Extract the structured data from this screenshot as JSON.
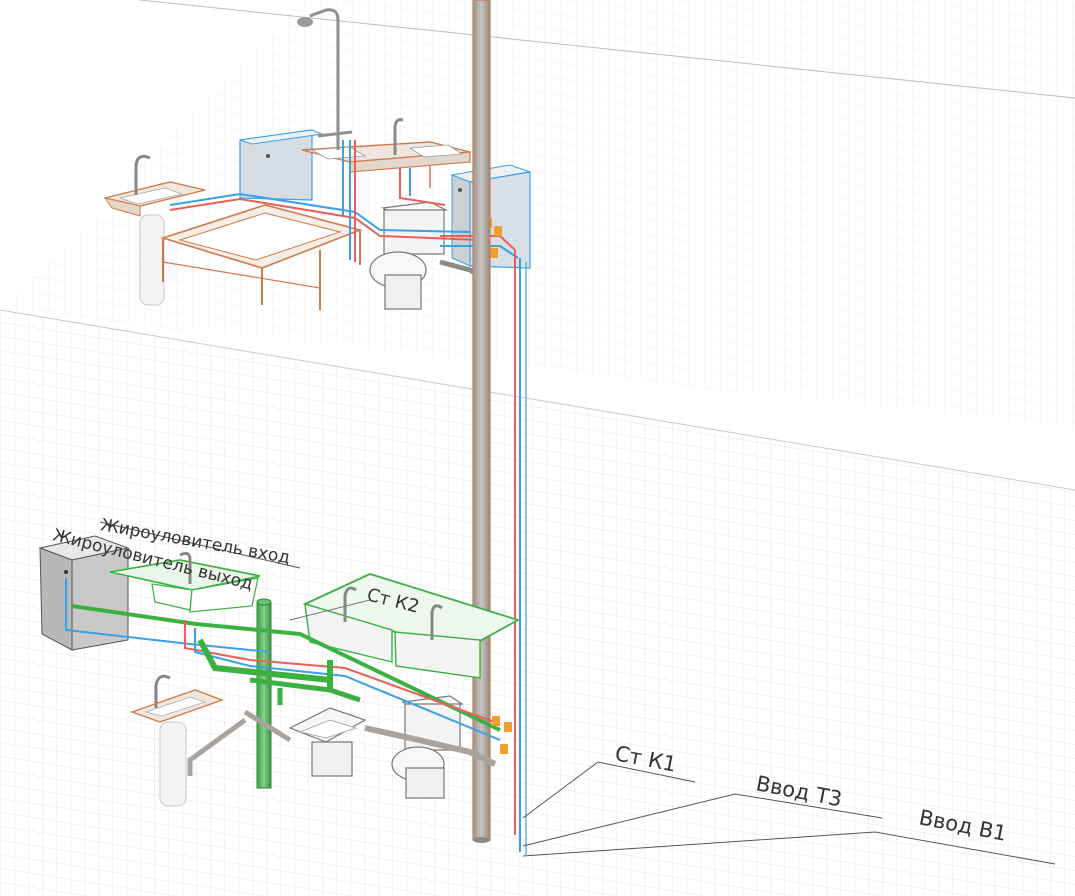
{
  "labels": {
    "grease_trap_in": "Жироуловитель вход",
    "grease_trap_out": "Жироуловитель выход",
    "riser_k2": "Ст К2",
    "riser_k1": "Ст К1",
    "inlet_t3": "Ввод Т3",
    "inlet_v1": "Ввод В1"
  },
  "colors": {
    "hot_pipe": "#e8605a",
    "cold_pipe": "#3aa0e8",
    "sewer_pipe": "#a8a39e",
    "selected_pipe": "#3cb043",
    "fixture_outline": "#d07a4a",
    "fixture_fill": "#f6f6f6",
    "grid": "#e2e2e2",
    "valve": "#f0a030"
  }
}
